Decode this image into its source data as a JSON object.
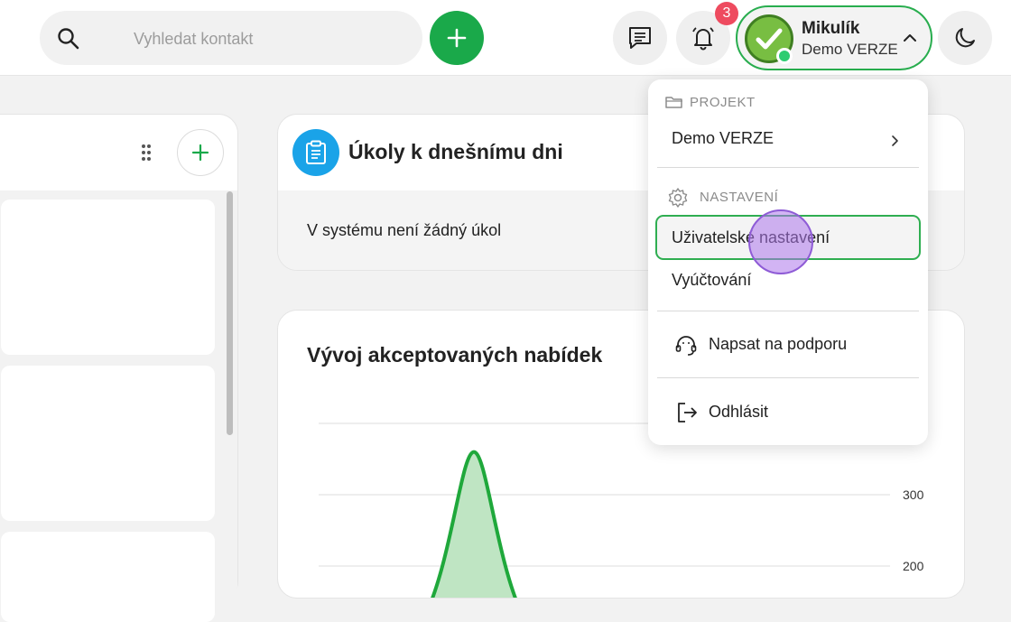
{
  "topbar": {
    "search_placeholder": "Vyhledat kontakt",
    "notification_count": "3",
    "user": {
      "name": "Mikulík",
      "company": "Demo VERZE"
    }
  },
  "tasks_card": {
    "title": "Úkoly k dnešnímu dni",
    "empty_text": "V systému není žádný úkol"
  },
  "chart_card": {
    "title": "Vývoj akceptovaných nabídek"
  },
  "chart_data": {
    "type": "area",
    "title": "Vývoj akceptovaných nabídek",
    "y_ticks": [
      300,
      200
    ],
    "series": [
      {
        "color": "#1fa83b",
        "values": [
          0,
          0,
          360,
          0,
          0,
          0,
          0,
          0
        ]
      }
    ]
  },
  "dropdown": {
    "project_section": "PROJEKT",
    "project_item": "Demo VERZE",
    "settings_section": "NASTAVENÍ",
    "user_settings": "Uživatelské nastavení",
    "billing": "Vyúčtování",
    "support": "Napsat na podporu",
    "logout": "Odhlásit"
  },
  "colors": {
    "brand_green": "#1aa94a",
    "accent_blue": "#1aa3e8",
    "badge_red": "#ee4b5f"
  }
}
